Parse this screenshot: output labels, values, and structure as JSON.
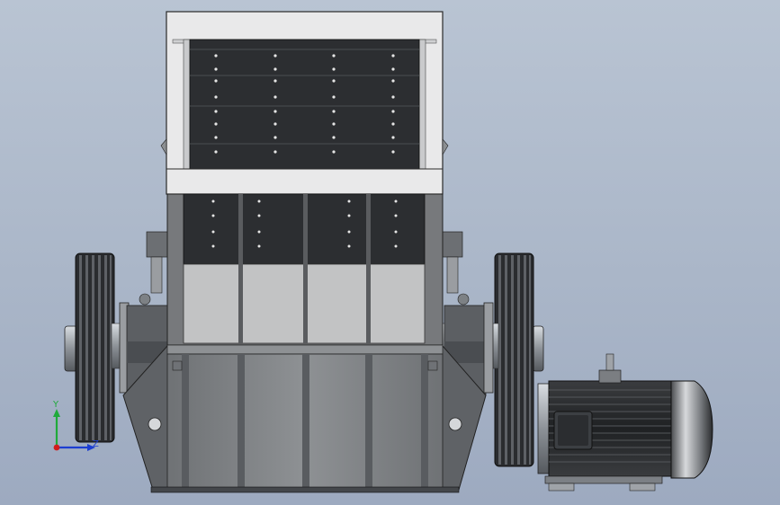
{
  "scene": {
    "subject": "hammer-crusher-front-view",
    "colors": {
      "background_top": "#b9c4d3",
      "background_bottom": "#9daac0",
      "hopper_frame": "#e9e9ea",
      "dark_liner": "#2c2e31",
      "body_grey": "#8a8d90",
      "light_panel": "#c2c3c4",
      "motor_dark": "#2b2d2f",
      "steel": "#b8bcc2"
    }
  },
  "triad": {
    "y_label": "Y",
    "z_label": "Z",
    "y_color": "#1faa3a",
    "z_color": "#1c3ed1",
    "origin_color": "#d11c1c"
  }
}
